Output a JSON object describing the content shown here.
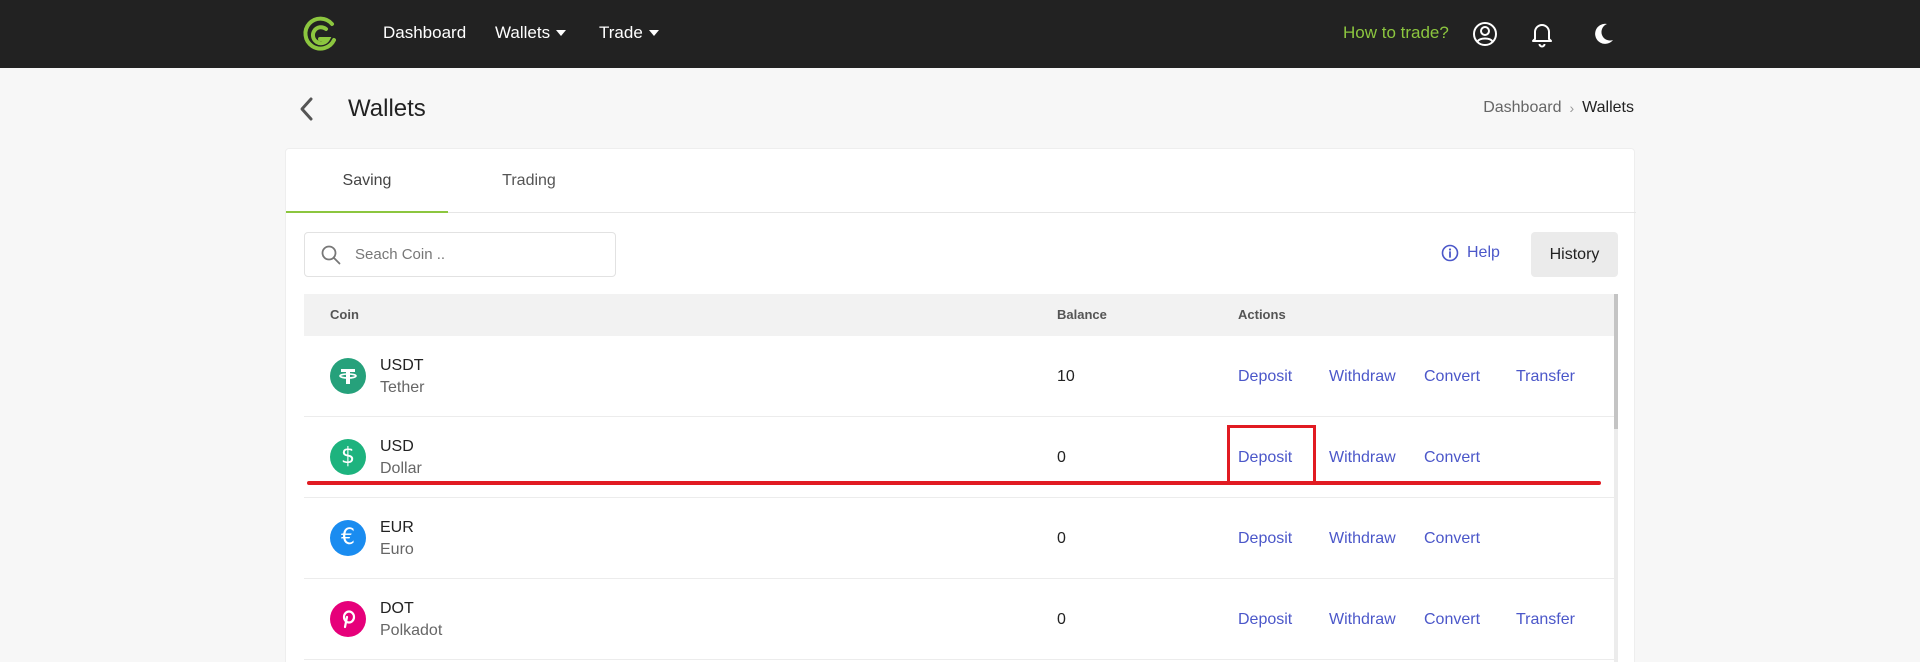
{
  "nav": {
    "items": [
      {
        "label": "Dashboard"
      },
      {
        "label": "Wallets"
      },
      {
        "label": "Trade"
      }
    ],
    "how_to_trade": "How to trade?"
  },
  "header": {
    "title": "Wallets",
    "breadcrumb": [
      "Dashboard",
      "Wallets"
    ]
  },
  "tabs": [
    "Saving",
    "Trading"
  ],
  "search": {
    "placeholder": "Seach Coin .."
  },
  "help_label": "Help",
  "history_label": "History",
  "table": {
    "columns": [
      "Coin",
      "Balance",
      "Actions"
    ],
    "rows": [
      {
        "symbol": "USDT",
        "name": "Tether",
        "balance": "10",
        "icon": "tether-icon",
        "color": "#26a17b",
        "actions": [
          "Deposit",
          "Withdraw",
          "Convert",
          "Transfer"
        ]
      },
      {
        "symbol": "USD",
        "name": "Dollar",
        "balance": "0",
        "icon": "dollar-icon",
        "color": "#1db37e",
        "actions": [
          "Deposit",
          "Withdraw",
          "Convert"
        ]
      },
      {
        "symbol": "EUR",
        "name": "Euro",
        "balance": "0",
        "icon": "euro-icon",
        "color": "#1a8cf0",
        "actions": [
          "Deposit",
          "Withdraw",
          "Convert"
        ]
      },
      {
        "symbol": "DOT",
        "name": "Polkadot",
        "balance": "0",
        "icon": "polkadot-icon",
        "color": "#e6007a",
        "actions": [
          "Deposit",
          "Withdraw",
          "Convert",
          "Transfer"
        ]
      }
    ]
  },
  "colors": {
    "accent": "#8cc63f",
    "link": "#4b57c9",
    "topbar": "#222222",
    "annotation": "#e11b22"
  }
}
